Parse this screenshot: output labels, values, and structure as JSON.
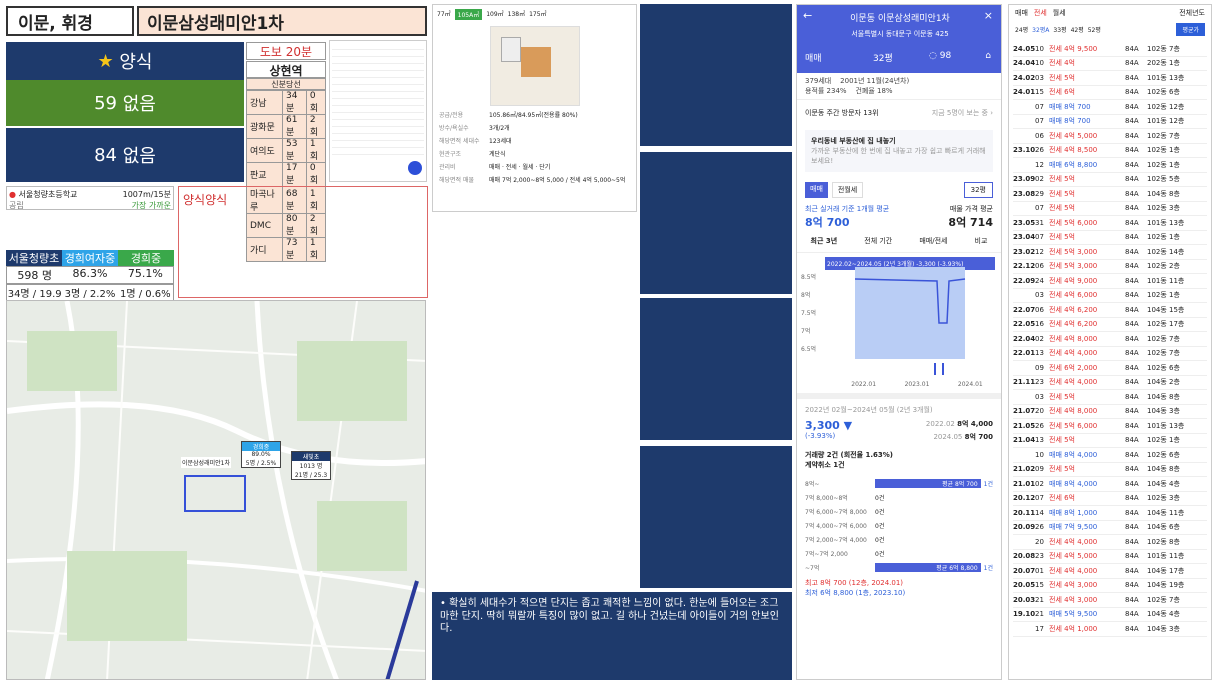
{
  "header": {
    "area": "이문, 휘경",
    "complex": "이문삼성래미안1차"
  },
  "style": {
    "star": "★",
    "label": "양식"
  },
  "rows": [
    {
      "n": "59",
      "t": "없음"
    },
    {
      "n": "84",
      "t": "없음"
    }
  ],
  "station": {
    "walk": "도보 20분",
    "name": "상현역",
    "line": "신분당선",
    "times": [
      [
        "강남",
        "34분",
        "0회"
      ],
      [
        "광화문",
        "61분",
        "2회"
      ],
      [
        "여의도",
        "53분",
        "1회"
      ],
      [
        "판교",
        "17분",
        "0회"
      ],
      [
        "마곡나루",
        "68분",
        "1회"
      ],
      [
        "DMC",
        "80분",
        "2회"
      ],
      [
        "가디",
        "73분",
        "1회"
      ]
    ]
  },
  "schoolline": {
    "name": "서울청량초등학교",
    "dist": "1007m/15분",
    "sub": "공립",
    "sub2": "가장 가까운"
  },
  "note_red": "양식양식",
  "schools": [
    {
      "name": "서울청량초",
      "v1": "598 명",
      "v2": "34명 / 19.9"
    },
    {
      "name": "경희여자중",
      "v1": "86.3%",
      "v2": "3명 / 2.2%"
    },
    {
      "name": "경희중",
      "v1": "75.1%",
      "v2": "1명 / 0.6%"
    }
  ],
  "map": {
    "lbl1": "이문삼성래미안1차",
    "lbl2": "경희중",
    "lbl3": "89.0%",
    "lbl4": "5명 / 2.5%",
    "lbl5": "새빛초",
    "lbl6": "1013 명",
    "lbl7": "21명 / 25.3"
  },
  "floor": {
    "tabs": [
      "77㎡",
      "105A㎡",
      "109㎡",
      "138㎡",
      "175㎡"
    ],
    "info": [
      [
        "공급/전용",
        "105.86㎡/84.95㎡(전용률 80%)"
      ],
      [
        "방수/욕실수",
        "3개/2개"
      ],
      [
        "해당면적 세대수",
        "123세대"
      ],
      [
        "현관구조",
        "계단식"
      ],
      [
        "관리비",
        "매매 · 전세 · 월세 · 단기"
      ],
      [
        "해당면적 매물",
        "매매 7억 2,000~8억 5,000 / 전세 4억 5,000~5억"
      ]
    ]
  },
  "comment": "확실히 세대수가 적으면 단지는 좁고 쾌적한 느낌이 없다. 한눈에 들어오는 조그마한 단지. 딱히 뭐랄까 특징이 많이 없고. 길 하나 건넜는데 아이들이 거의 안보인다.",
  "phone": {
    "title": "이문동 이문삼성래미안1차",
    "addr": "서울특별시 동대문구 이문동 425",
    "tab1": "매매",
    "tab2": "32평",
    "cmt": "98",
    "hh": "379세대",
    "yr": "2001년 11월(24년차)",
    "fa": "용적률 234%",
    "bc": "건폐율 18%",
    "vis": "이문동 주간 방문자 13위",
    "vis2": "지금 5명이 보는 중 ›",
    "banner": "우리동네 부동산에 집 내놓기",
    "banner2": "가까운 부동산에 한 번에 집 내놓고 가장 쉽고 빠르게 거래해보세요!",
    "b1": "매매",
    "b2": "전월세",
    "sz": "32평",
    "avg": "최근 실거래 기준 1개월 평균",
    "avgv": "8억 700",
    "ask": "매물 가격 평균",
    "askv": "8억 714",
    "rt": [
      "최근 3년",
      "전체 기간",
      "매매/전세",
      "비교"
    ],
    "chartcap": "2022.02~2024.05 (2년 3개월) -3,300 (-3.93%)",
    "yt": [
      "8.5억",
      "8억",
      "7.5억",
      "7억",
      "6.5억"
    ],
    "xt": [
      "2022.01",
      "2023.01",
      "2024.01"
    ],
    "per": "2022년 02월~2024년 05월 (2년 3개월)",
    "chg": "3,300 ▼",
    "pct": "(-3.93%)",
    "p1d": "2022.02",
    "p1": "8억 4,000",
    "p2d": "2024.05",
    "p2": "8억 700",
    "vol": "거래량 2건 (회전율 1.63%)",
    "cancel": "계약취소 1건",
    "dist": [
      [
        "8억~",
        "평균 8억 700",
        "1건"
      ],
      [
        "7억 8,000~8억",
        "0건"
      ],
      [
        "7억 6,000~7억 8,000",
        "0건"
      ],
      [
        "7억 4,000~7억 6,000",
        "0건"
      ],
      [
        "7억 2,000~7억 4,000",
        "0건"
      ],
      [
        "7억~7억 2,000",
        "0건"
      ],
      [
        "~7억",
        "평균 6억 8,800",
        "1건"
      ]
    ],
    "hi": "최고 8억 700 (12층, 2024.01)",
    "lo": "최저 6억 8,800 (1층, 2023.10)"
  },
  "listing": {
    "tabs": [
      "매매",
      "전세",
      "월세"
    ],
    "all": "전체년도",
    "cols": [
      "24평",
      "32평A",
      "33평",
      "42평",
      "52평"
    ],
    "btn": "평균가",
    "rows": [
      [
        "24.05",
        "10",
        "전세 4억 9,500",
        "84A",
        "102동 7층"
      ],
      [
        "24.04",
        "10",
        "전세 4억",
        "84A",
        "202동 1층"
      ],
      [
        "24.02",
        "03",
        "전세 5억",
        "84A",
        "101동 13층"
      ],
      [
        "24.01",
        "15",
        "전세 6억",
        "84A",
        "102동 6층"
      ],
      [
        "",
        "07",
        "매매 8억 700",
        "84A",
        "102동 12층"
      ],
      [
        "",
        "07",
        "매매 8억 700",
        "84A",
        "101동 12층"
      ],
      [
        "",
        "06",
        "전세 4억 5,000",
        "84A",
        "102동 7층"
      ],
      [
        "23.10",
        "26",
        "전세 4억 8,500",
        "84A",
        "102동 1층"
      ],
      [
        "",
        "12",
        "매매 6억 8,800",
        "84A",
        "102동 1층"
      ],
      [
        "23.09",
        "02",
        "전세 5억",
        "84A",
        "102동 5층"
      ],
      [
        "23.08",
        "29",
        "전세 5억",
        "84A",
        "104동 8층"
      ],
      [
        "",
        "07",
        "전세 5억",
        "84A",
        "102동 3층"
      ],
      [
        "23.05",
        "31",
        "전세 5억 6,000",
        "84A",
        "101동 13층"
      ],
      [
        "23.04",
        "07",
        "전세 5억",
        "84A",
        "102동 1층"
      ],
      [
        "23.02",
        "12",
        "전세 5억 3,000",
        "84A",
        "102동 14층"
      ],
      [
        "22.12",
        "06",
        "전세 5억 3,000",
        "84A",
        "102동 2층"
      ],
      [
        "22.09",
        "24",
        "전세 4억 9,000",
        "84A",
        "101동 11층"
      ],
      [
        "",
        "03",
        "전세 4억 6,000",
        "84A",
        "102동 1층"
      ],
      [
        "22.07",
        "06",
        "전세 4억 6,200",
        "84A",
        "104동 15층"
      ],
      [
        "22.05",
        "16",
        "전세 4억 6,200",
        "84A",
        "102동 17층"
      ],
      [
        "22.04",
        "02",
        "전세 4억 8,000",
        "84A",
        "102동 7층"
      ],
      [
        "22.01",
        "13",
        "전세 4억 4,000",
        "84A",
        "102동 7층"
      ],
      [
        "",
        "09",
        "전세 6억 2,000",
        "84A",
        "102동 6층"
      ],
      [
        "21.11",
        "23",
        "전세 4억 4,000",
        "84A",
        "104동 2층"
      ],
      [
        "",
        "03",
        "전세 5억",
        "84A",
        "104동 8층"
      ],
      [
        "21.07",
        "20",
        "전세 4억 8,000",
        "84A",
        "104동 3층"
      ],
      [
        "21.05",
        "26",
        "전세 5억 6,000",
        "84A",
        "101동 13층"
      ],
      [
        "21.04",
        "13",
        "전세 5억",
        "84A",
        "102동 1층"
      ],
      [
        "",
        "10",
        "매매 8억 4,000",
        "84A",
        "102동 6층"
      ],
      [
        "21.02",
        "09",
        "전세 5억",
        "84A",
        "104동 8층"
      ],
      [
        "21.01",
        "02",
        "매매 8억 4,000",
        "84A",
        "104동 4층"
      ],
      [
        "20.12",
        "07",
        "전세 6억",
        "84A",
        "102동 3층"
      ],
      [
        "20.11",
        "14",
        "매매 8억 1,000",
        "84A",
        "104동 11층"
      ],
      [
        "20.09",
        "26",
        "매매 7억 9,500",
        "84A",
        "104동 6층"
      ],
      [
        "",
        "20",
        "전세 4억 4,000",
        "84A",
        "102동 8층"
      ],
      [
        "20.08",
        "23",
        "전세 4억 5,000",
        "84A",
        "101동 11층"
      ],
      [
        "20.07",
        "01",
        "전세 4억 4,000",
        "84A",
        "104동 17층"
      ],
      [
        "20.05",
        "15",
        "전세 4억 3,000",
        "84A",
        "104동 19층"
      ],
      [
        "20.03",
        "21",
        "전세 4억 3,000",
        "84A",
        "102동 7층"
      ],
      [
        "19.10",
        "21",
        "매매 5억 9,500",
        "84A",
        "104동 4층"
      ],
      [
        "",
        "17",
        "전세 4억 1,000",
        "84A",
        "104동 3층"
      ]
    ]
  }
}
